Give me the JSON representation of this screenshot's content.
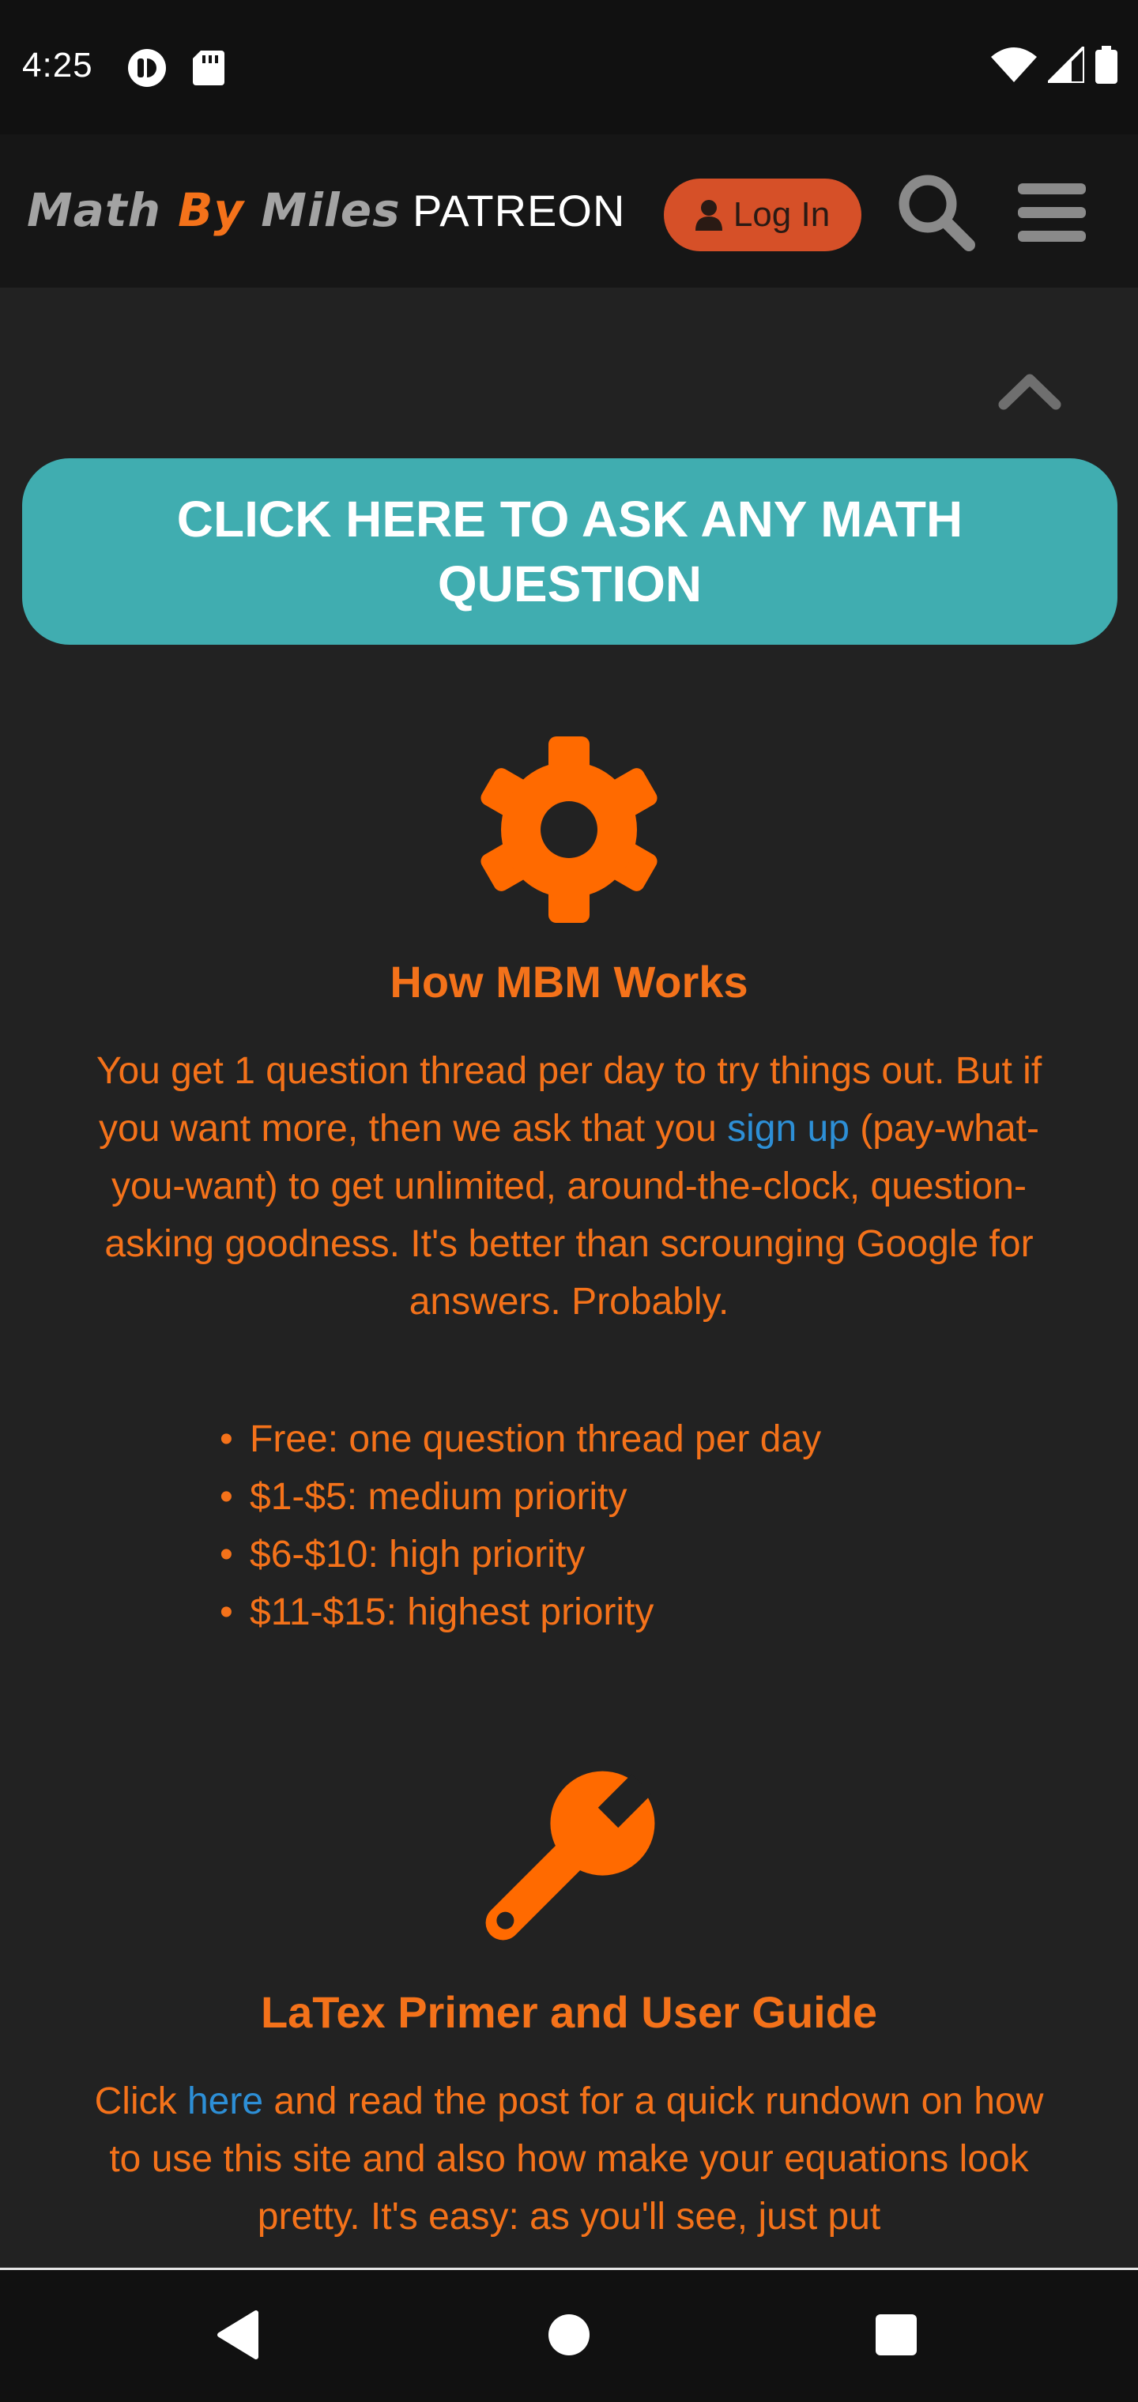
{
  "status_bar": {
    "time": "4:25"
  },
  "header": {
    "logo_math": "Math",
    "logo_by": "By",
    "logo_miles": "Miles",
    "patreon_label": "PATREON",
    "login_label": "Log In",
    "icons": [
      "user-icon",
      "search-icon",
      "hamburger-menu-icon"
    ]
  },
  "cta": {
    "label": "CLICK HERE TO ASK ANY MATH QUESTION"
  },
  "how_it_works": {
    "icon": "gear-icon",
    "title": "How MBM Works",
    "body_before_link": "You get 1 question thread per day to try things out. But if you want more, then we ask that you ",
    "link_text": "sign up",
    "body_after_link": " (pay-what-you-want) to get unlimited, around-the-clock, question-asking goodness. It's better than scrounging Google for answers. Probably.",
    "tiers": [
      "Free: one question thread per day",
      "$1-$5: medium priority",
      "$6-$10: high priority",
      "$11-$15: highest priority"
    ]
  },
  "latex_guide": {
    "icon": "wrench-icon",
    "title": "LaTex Primer and User Guide",
    "body_before_link": "Click ",
    "link_text": "here",
    "body_after_link": " and read the post for a quick rundown on how to use this site and also how make your equations look pretty. It's easy: as you'll see, just put"
  },
  "colors": {
    "accent_orange": "#f4721a",
    "cta_teal": "#40adb0",
    "login_red": "#d65028",
    "link_blue": "#2d8fd6",
    "background": "#222222"
  }
}
